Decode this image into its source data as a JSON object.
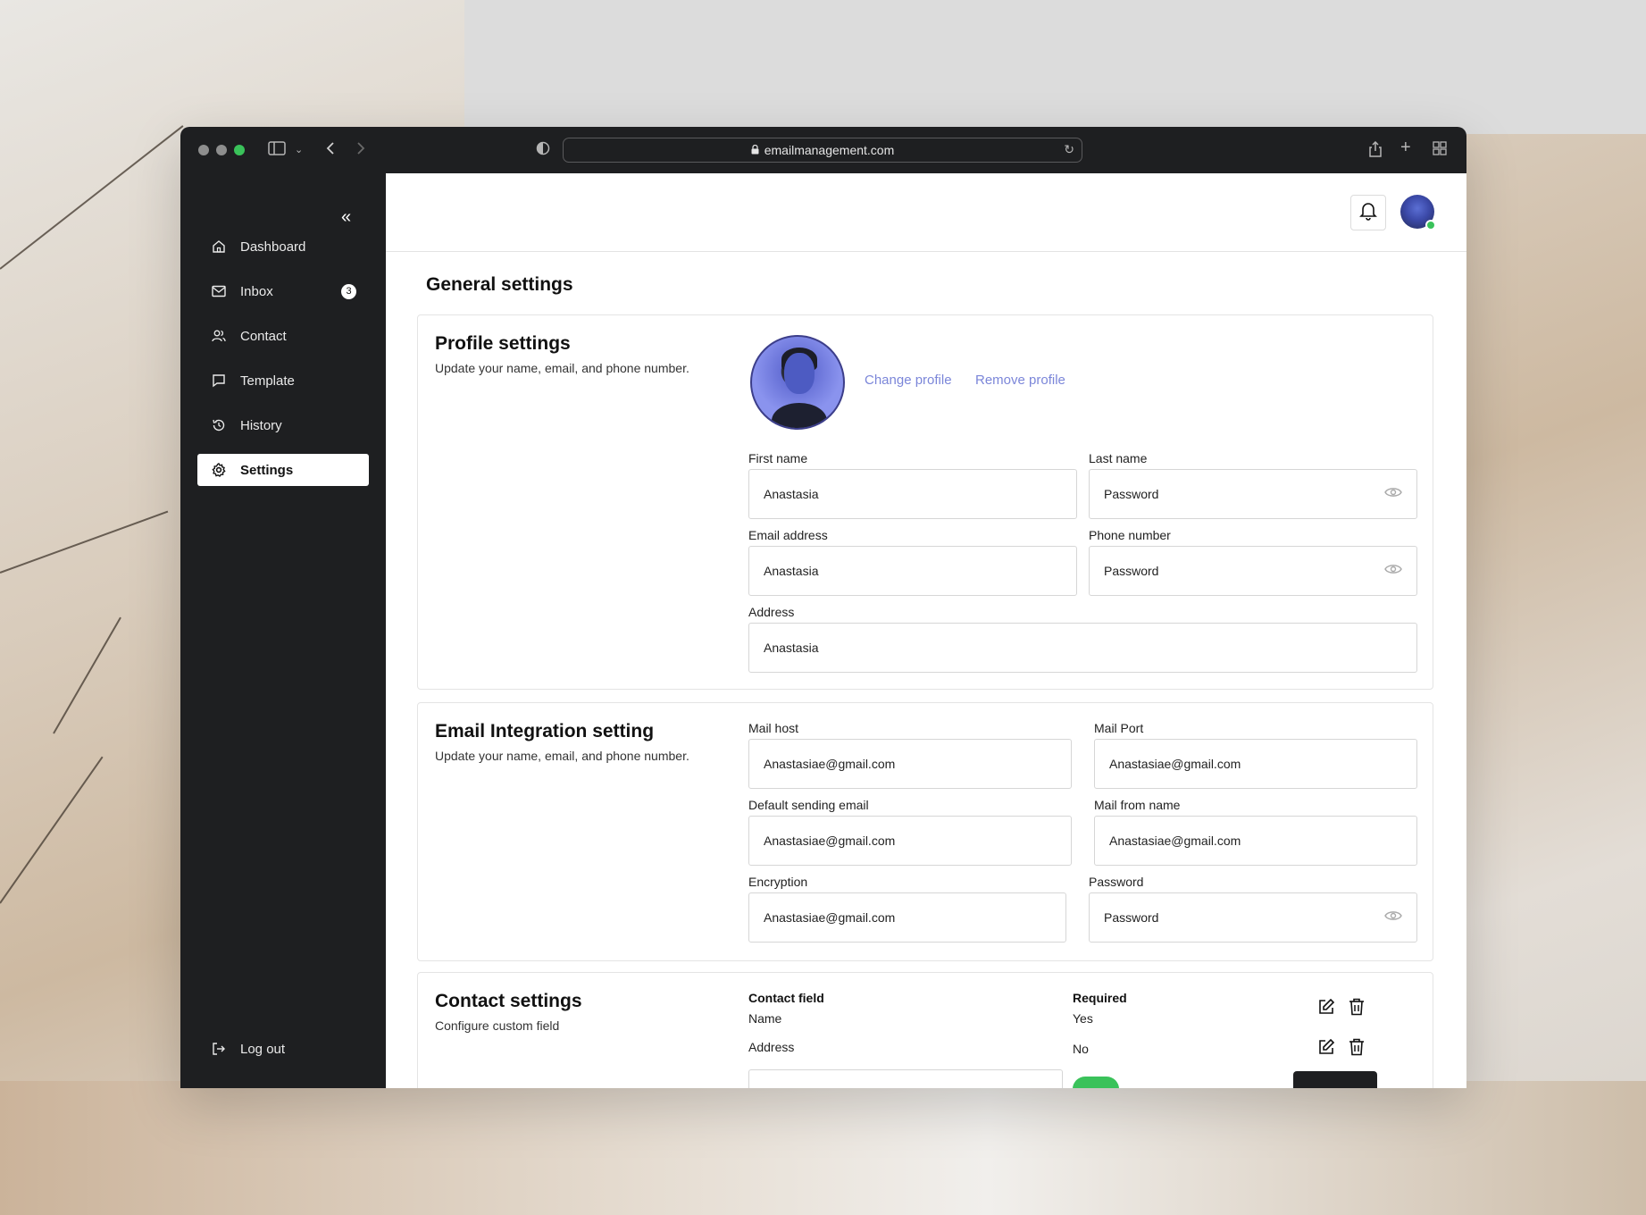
{
  "browser": {
    "url": "emailmanagement.com"
  },
  "sidebar": {
    "items": [
      {
        "label": "Dashboard",
        "icon": "home-icon"
      },
      {
        "label": "Inbox",
        "icon": "mail-icon",
        "badge": "3"
      },
      {
        "label": "Contact",
        "icon": "users-icon"
      },
      {
        "label": "Template",
        "icon": "message-icon"
      },
      {
        "label": "History",
        "icon": "history-icon"
      },
      {
        "label": "Settings",
        "icon": "gear-icon",
        "active": true
      }
    ],
    "logout_label": "Log out"
  },
  "page": {
    "title": "General settings"
  },
  "profile": {
    "title": "Profile settings",
    "subtitle": "Update your name, email, and phone number.",
    "change_label": "Change profile",
    "remove_label": "Remove profile",
    "fields": {
      "first_name": {
        "label": "First name",
        "value": "Anastasia"
      },
      "last_name": {
        "label": "Last name",
        "value": "Password"
      },
      "email": {
        "label": "Email address",
        "value": "Anastasia"
      },
      "phone": {
        "label": "Phone number",
        "value": "Password"
      },
      "address": {
        "label": "Address",
        "value": "Anastasia"
      }
    }
  },
  "email_integration": {
    "title": "Email Integration setting",
    "subtitle": "Update your name, email, and phone number.",
    "fields": {
      "mail_host": {
        "label": "Mail host",
        "value": "Anastasiae@gmail.com"
      },
      "mail_port": {
        "label": "Mail Port",
        "value": "Anastasiae@gmail.com"
      },
      "default_email": {
        "label": "Default sending email",
        "value": "Anastasiae@gmail.com"
      },
      "from_name": {
        "label": "Mail from name",
        "value": "Anastasiae@gmail.com"
      },
      "encryption": {
        "label": "Encryption",
        "value": "Anastasiae@gmail.com"
      },
      "password": {
        "label": "Password",
        "value": "Password"
      }
    }
  },
  "contact_settings": {
    "title": "Contact settings",
    "subtitle": "Configure custom field",
    "headers": {
      "field": "Contact field",
      "required": "Required"
    },
    "rows": [
      {
        "field": "Name",
        "required": "Yes"
      },
      {
        "field": "Address",
        "required": "No"
      }
    ]
  },
  "colors": {
    "sidebar_bg": "#1e1f21",
    "link": "#7b86d9",
    "online": "#3ac25a"
  }
}
